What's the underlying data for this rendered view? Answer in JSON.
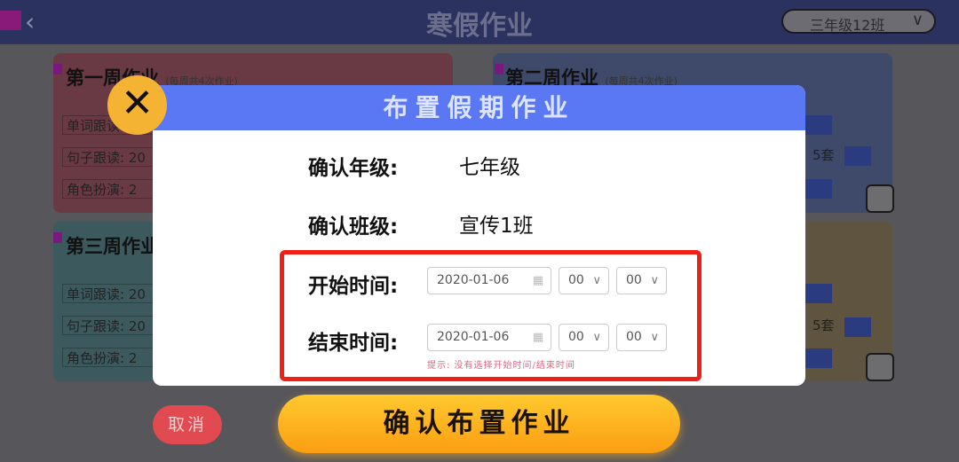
{
  "header": {
    "title": "寒假作业",
    "back_icon": "chevron-left-icon",
    "class_select": "三年级12班"
  },
  "cards": [
    {
      "title": "第一周作业",
      "note": "(每周共4次作业)",
      "rows": [
        "单词跟读: 20",
        "句子跟读: 20",
        "角色扮演: 2"
      ],
      "color": "#6a3a44"
    },
    {
      "title": "第二周作业",
      "note": "(每周共4次作业)",
      "rows": [
        "5套"
      ],
      "color": "#3f4a6a"
    },
    {
      "title": "第三周作业",
      "note": "",
      "rows": [
        "单词跟读: 20",
        "句子跟读: 20",
        "角色扮演: 2"
      ],
      "color": "#3c5a5e"
    },
    {
      "title": "",
      "note": "",
      "rows": [
        "5套"
      ],
      "color": "#5e5440"
    }
  ],
  "modal": {
    "title": "布置假期作业",
    "grade_label": "确认年级:",
    "grade_value": "七年级",
    "class_label": "确认班级:",
    "class_value": "宣传1班",
    "start_label": "开始时间:",
    "start_date": "2020-01-06",
    "start_hour": "00",
    "start_minute": "00",
    "end_label": "结束时间:",
    "end_date": "2020-01-06",
    "end_hour": "00",
    "end_minute": "00",
    "hint": "提示: 没有选择开始时间/结束时间"
  },
  "buttons": {
    "cancel": "取消",
    "confirm": "确认布置作业"
  },
  "colors": {
    "modal_header": "#5a78f4",
    "close_button": "#f5b333",
    "highlight_border": "#ee2018",
    "confirm": "#fcb01e",
    "cancel": "#e04a50"
  }
}
